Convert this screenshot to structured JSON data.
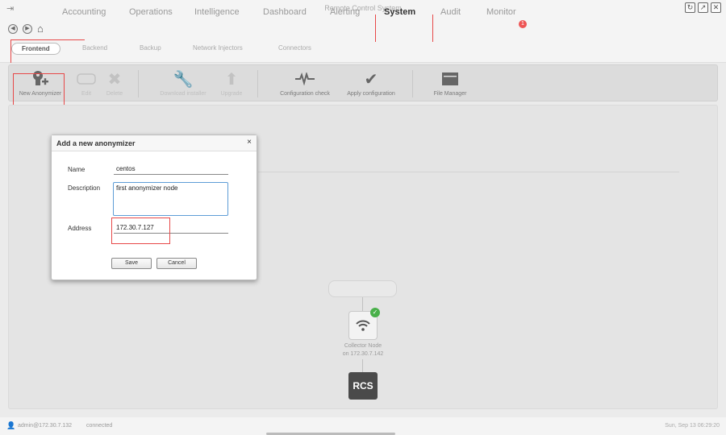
{
  "window": {
    "title": "Remote Control System"
  },
  "main_tabs": [
    {
      "label": "Accounting"
    },
    {
      "label": "Operations"
    },
    {
      "label": "Intelligence"
    },
    {
      "label": "Dashboard"
    },
    {
      "label": "Alerting"
    },
    {
      "label": "System",
      "active": true
    },
    {
      "label": "Audit"
    },
    {
      "label": "Monitor",
      "badge": "1"
    }
  ],
  "sub_tabs": [
    {
      "label": "Frontend",
      "active": true
    },
    {
      "label": "Backend"
    },
    {
      "label": "Backup"
    },
    {
      "label": "Network Injectors"
    },
    {
      "label": "Connectors"
    }
  ],
  "toolbar": {
    "new_anonymizer": "New Anonymizer",
    "edit": "Edit",
    "delete": "Delete",
    "download_installer": "Download installer",
    "upgrade": "Upgrade",
    "configuration_check": "Configuration check",
    "apply_configuration": "Apply configuration",
    "file_manager": "File Manager"
  },
  "canvas": {
    "collector_label_1": "Collector Node",
    "collector_label_2": "on 172.30.7.142",
    "rcs_label": "RCS"
  },
  "dialog": {
    "title": "Add a new anonymizer",
    "name_label": "Name",
    "name_value": "centos",
    "description_label": "Description",
    "description_value": "first anonymizer node",
    "address_label": "Address",
    "address_value": "172.30.7.127",
    "save_label": "Save",
    "cancel_label": "Cancel"
  },
  "status": {
    "user": "admin@172.30.7.132",
    "connection": "connected",
    "datetime": "Sun, Sep 13   06:29:20"
  },
  "colors": {
    "accent_red": "#e74848",
    "ok_green": "#49b04a",
    "focus_blue": "#5e9dd6"
  }
}
